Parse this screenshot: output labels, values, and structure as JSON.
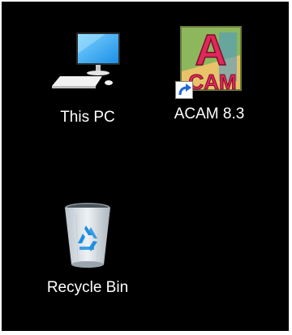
{
  "desktop": {
    "background_color": "#000000",
    "icons": [
      {
        "label": "This PC",
        "icon": "computer-icon"
      },
      {
        "label": "ACAM 8.3",
        "icon": "acam-app-icon",
        "shortcut": true
      },
      {
        "label": "Recycle Bin",
        "icon": "recycle-bin-icon"
      }
    ]
  }
}
